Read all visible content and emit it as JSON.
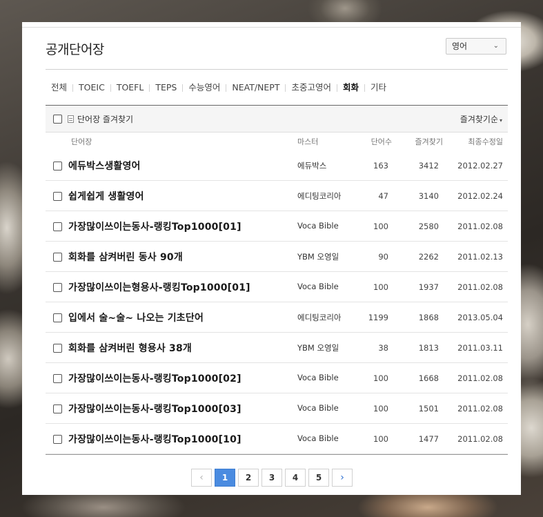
{
  "page": {
    "title": "공개단어장",
    "language_select": "영어"
  },
  "categories": [
    {
      "label": "전체",
      "active": false
    },
    {
      "label": "TOEIC",
      "active": false
    },
    {
      "label": "TOEFL",
      "active": false
    },
    {
      "label": "TEPS",
      "active": false
    },
    {
      "label": "수능영어",
      "active": false
    },
    {
      "label": "NEAT/NEPT",
      "active": false
    },
    {
      "label": "초중고영어",
      "active": false
    },
    {
      "label": "회화",
      "active": true
    },
    {
      "label": "기타",
      "active": false
    }
  ],
  "toolbar": {
    "favorite_label": "단어장 즐겨찾기",
    "sort_label": "즐겨찾기순"
  },
  "table": {
    "columns": [
      "단어장",
      "마스터",
      "단어수",
      "즐겨찾기",
      "최종수정일"
    ],
    "rows": [
      {
        "title": "에듀박스생활영어",
        "master": "에듀박스",
        "count": "163",
        "fav": "3412",
        "date": "2012.02.27"
      },
      {
        "title": "쉽게쉽게 생활영어",
        "master": "에디팅코리아",
        "count": "47",
        "fav": "3140",
        "date": "2012.02.24"
      },
      {
        "title": "가장많이쓰이는동사-랭킹Top1000[01]",
        "master": "Voca Bible",
        "count": "100",
        "fav": "2580",
        "date": "2011.02.08"
      },
      {
        "title": "회화를 삼켜버린 동사 90개",
        "master": "YBM 오영일",
        "count": "90",
        "fav": "2262",
        "date": "2011.02.13"
      },
      {
        "title": "가장많이쓰이는형용사-랭킹Top1000[01]",
        "master": "Voca Bible",
        "count": "100",
        "fav": "1937",
        "date": "2011.02.08"
      },
      {
        "title": "입에서 술~술~ 나오는 기초단어",
        "master": "에디팅코리아",
        "count": "1199",
        "fav": "1868",
        "date": "2013.05.04"
      },
      {
        "title": "회화를 삼켜버린 형용사 38개",
        "master": "YBM 오영일",
        "count": "38",
        "fav": "1813",
        "date": "2011.03.11"
      },
      {
        "title": "가장많이쓰이는동사-랭킹Top1000[02]",
        "master": "Voca Bible",
        "count": "100",
        "fav": "1668",
        "date": "2011.02.08"
      },
      {
        "title": "가장많이쓰이는동사-랭킹Top1000[03]",
        "master": "Voca Bible",
        "count": "100",
        "fav": "1501",
        "date": "2011.02.08"
      },
      {
        "title": "가장많이쓰이는동사-랭킹Top1000[10]",
        "master": "Voca Bible",
        "count": "100",
        "fav": "1477",
        "date": "2011.02.08"
      }
    ]
  },
  "pagination": {
    "prev_icon": "chevron-left-icon",
    "next_icon": "chevron-right-icon",
    "pages": [
      "1",
      "2",
      "3",
      "4",
      "5"
    ],
    "current": "1"
  },
  "colors": {
    "accent": "#4a8be0"
  }
}
